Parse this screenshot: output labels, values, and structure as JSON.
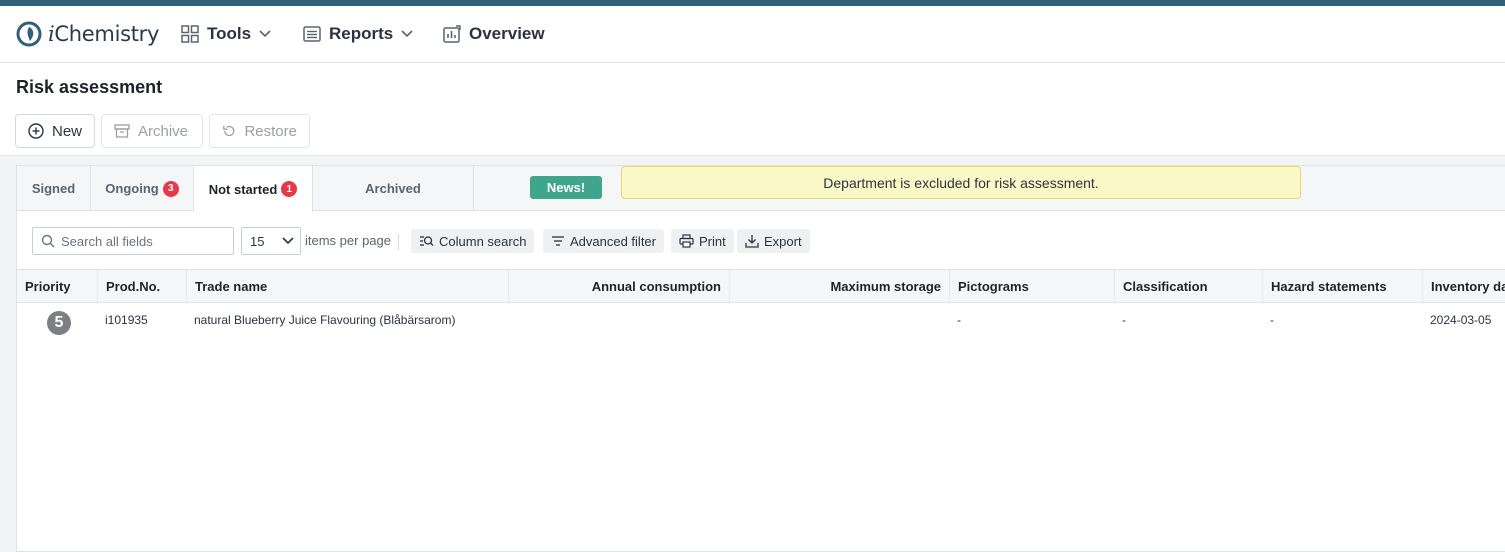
{
  "app": {
    "name_prefix": "i",
    "name_rest": "Chemistry"
  },
  "nav": {
    "tools": "Tools",
    "reports": "Reports",
    "overview": "Overview"
  },
  "page": {
    "title": "Risk assessment"
  },
  "actions": {
    "new": "New",
    "archive": "Archive",
    "restore": "Restore"
  },
  "tabs": [
    {
      "label": "Signed",
      "badge": null
    },
    {
      "label": "Ongoing",
      "badge": "3"
    },
    {
      "label": "Not started",
      "badge": "1"
    },
    {
      "label": "Archived",
      "badge": null
    }
  ],
  "active_tab": "Not started",
  "news": "News!",
  "notice": "Department is excluded for risk assessment.",
  "toolbar": {
    "search_placeholder": "Search all fields",
    "per_page_value": "15",
    "per_page_label": "items per page",
    "column_search": "Column search",
    "advanced_filter": "Advanced filter",
    "print": "Print",
    "export": "Export"
  },
  "table": {
    "columns": [
      "Priority",
      "Prod.No.",
      "Trade name",
      "Annual consumption",
      "Maximum storage",
      "Pictograms",
      "Classification",
      "Hazard statements",
      "Inventory da"
    ],
    "rows": [
      {
        "priority": "5",
        "prod_no": "i101935",
        "trade_name": "natural Blueberry Juice Flavouring (Blåbärsarom)",
        "annual_consumption": "",
        "maximum_storage": "",
        "pictograms": "-",
        "classification": "-",
        "hazard_statements": "-",
        "inventory_date": "2024-03-05"
      }
    ]
  },
  "colors": {
    "accent_bar": "#2f5f7a",
    "news": "#3fa58c",
    "badge": "#e5394a",
    "notice_bg": "#fbf8c8"
  }
}
